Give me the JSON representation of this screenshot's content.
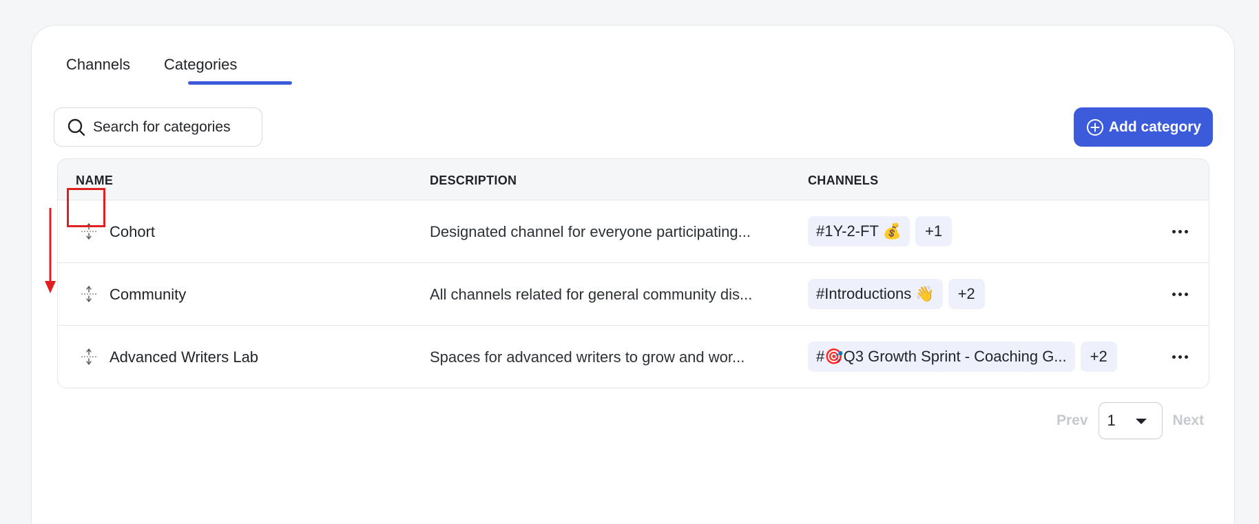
{
  "tabs": [
    {
      "label": "Channels"
    },
    {
      "label": "Categories"
    }
  ],
  "search": {
    "placeholder": "Search for categories",
    "icon": "search-icon"
  },
  "add_button": {
    "label": "Add category",
    "icon": "plus-circle-icon"
  },
  "table": {
    "columns": [
      "NAME",
      "DESCRIPTION",
      "CHANNELS"
    ],
    "rows": [
      {
        "name": "Cohort",
        "description": "Designated channel for everyone participating...",
        "channel": "#1Y-2-FT 💰",
        "more": "+1"
      },
      {
        "name": "Community",
        "description": "All channels related for general community dis...",
        "channel": "#Introductions 👋",
        "more": "+2"
      },
      {
        "name": "Advanced Writers Lab",
        "description": "Spaces for advanced writers to grow and wor...",
        "channel": "#🎯Q3 Growth Sprint - Coaching G...",
        "more": "+2"
      }
    ]
  },
  "pagination": {
    "prev": "Prev",
    "page": "1",
    "next": "Next"
  },
  "colors": {
    "accent": "#3b5bdb",
    "highlight": "#e02020",
    "chip_bg": "#eef1fb"
  }
}
